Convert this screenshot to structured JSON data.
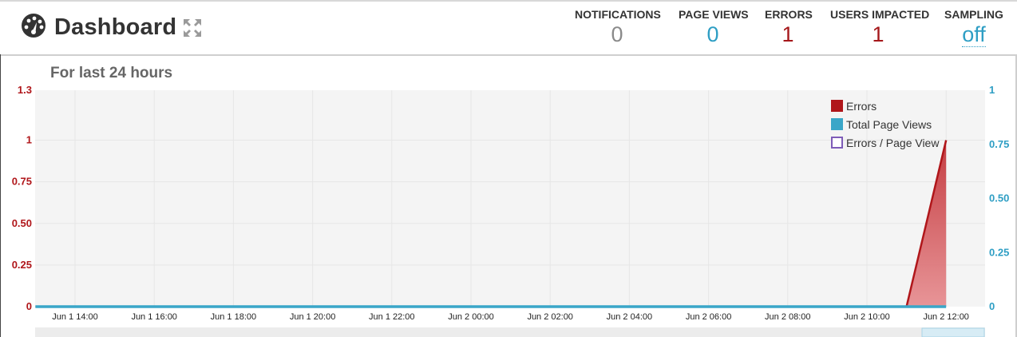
{
  "header": {
    "title": "Dashboard",
    "icon": "dashboard-gauge-icon",
    "expand_icon": "expand-arrows-icon",
    "stats": [
      {
        "label": "NOTIFICATIONS",
        "value": "0",
        "color": "#8a8a8a"
      },
      {
        "label": "PAGE VIEWS",
        "value": "0",
        "color": "#2e9ec4"
      },
      {
        "label": "ERRORS",
        "value": "1",
        "color": "#a5171a"
      },
      {
        "label": "USERS IMPACTED",
        "value": "1",
        "color": "#a5171a"
      },
      {
        "label": "SAMPLING",
        "value": "off",
        "color": "#2e9ec4"
      }
    ]
  },
  "section": {
    "title": "For last 24 hours"
  },
  "chart_data": {
    "type": "area",
    "title": "",
    "x": [
      "Jun 1 14:00",
      "Jun 1 16:00",
      "Jun 1 18:00",
      "Jun 1 20:00",
      "Jun 1 22:00",
      "Jun 2 00:00",
      "Jun 2 02:00",
      "Jun 2 04:00",
      "Jun 2 06:00",
      "Jun 2 08:00",
      "Jun 2 10:00",
      "Jun 2 12:00"
    ],
    "left_axis": {
      "ticks": [
        "0",
        "0.25",
        "0.50",
        "0.75",
        "1",
        "1.3"
      ],
      "range": [
        0,
        1.3
      ],
      "color": "#b0161a"
    },
    "right_axis": {
      "ticks": [
        "0",
        "0.25",
        "0.50",
        "0.75",
        "1"
      ],
      "range": [
        0,
        1
      ],
      "color": "#2e9ec4"
    },
    "series": [
      {
        "name": "Errors",
        "color": "#b0161a",
        "axis": "left",
        "points": [
          [
            "Jun 1 13:00",
            0
          ],
          [
            "Jun 2 11:00",
            0
          ],
          [
            "Jun 2 12:00",
            1
          ]
        ]
      },
      {
        "name": "Total Page Views",
        "color": "#3aa6c8",
        "axis": "right",
        "points": [
          [
            "Jun 1 13:00",
            0
          ],
          [
            "Jun 2 12:00",
            0
          ]
        ]
      },
      {
        "name": "Errors / Page View",
        "color": "#7e5cb8",
        "axis": "right",
        "points": []
      }
    ],
    "legend_position": "top-right",
    "grid": true
  }
}
